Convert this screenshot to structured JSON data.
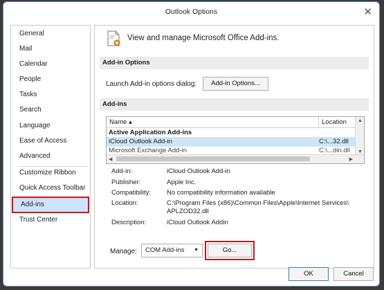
{
  "window": {
    "title": "Outlook Options"
  },
  "sidebar": {
    "items": [
      {
        "label": "General"
      },
      {
        "label": "Mail"
      },
      {
        "label": "Calendar"
      },
      {
        "label": "People"
      },
      {
        "label": "Tasks"
      },
      {
        "label": "Search"
      },
      {
        "label": "Language"
      },
      {
        "label": "Ease of Access"
      },
      {
        "label": "Advanced"
      },
      {
        "label": "Customize Ribbon"
      },
      {
        "label": "Quick Access Toolbar"
      },
      {
        "label": "Add-ins"
      },
      {
        "label": "Trust Center"
      }
    ],
    "selected": "Add-ins"
  },
  "main": {
    "header": "View and manage Microsoft Office Add-ins.",
    "addin_options": {
      "section_title": "Add-in Options",
      "launch_label": "Launch Add-in options dialog:",
      "button_label": "Add-in Options..."
    },
    "addins": {
      "section_title": "Add-ins",
      "columns": {
        "name": "Name ▴",
        "location": "Location"
      },
      "rows": [
        {
          "name": "Active Application Add-ins",
          "location": ""
        },
        {
          "name": "iCloud Outlook Add-in",
          "location": "C:\\...32.dll"
        },
        {
          "name": "Microsoft Exchange Add-in",
          "location": "C:\\...din.dll"
        }
      ],
      "selected_row": "iCloud Outlook Add-in"
    },
    "details": {
      "addin_label": "Add-in:",
      "addin_value": "iCloud Outlook Add-in",
      "publisher_label": "Publisher:",
      "publisher_value": "Apple Inc.",
      "compat_label": "Compatibility:",
      "compat_value": "No compatibility information available",
      "location_label": "Location:",
      "location_value": "C:\\Program Files (x86)\\Common Files\\Apple\\Internet Services\\ APLZOD32.dll",
      "description_label": "Description:",
      "description_value": "iCloud Outlook Addin"
    },
    "manage": {
      "label": "Manage:",
      "selected": "COM Add-ins",
      "go_label": "Go..."
    }
  },
  "footer": {
    "ok_label": "OK",
    "cancel_label": "Cancel"
  },
  "colors": {
    "highlight": "#c4161c",
    "selection": "#cfe3f8",
    "section_bg": "#ececec"
  }
}
